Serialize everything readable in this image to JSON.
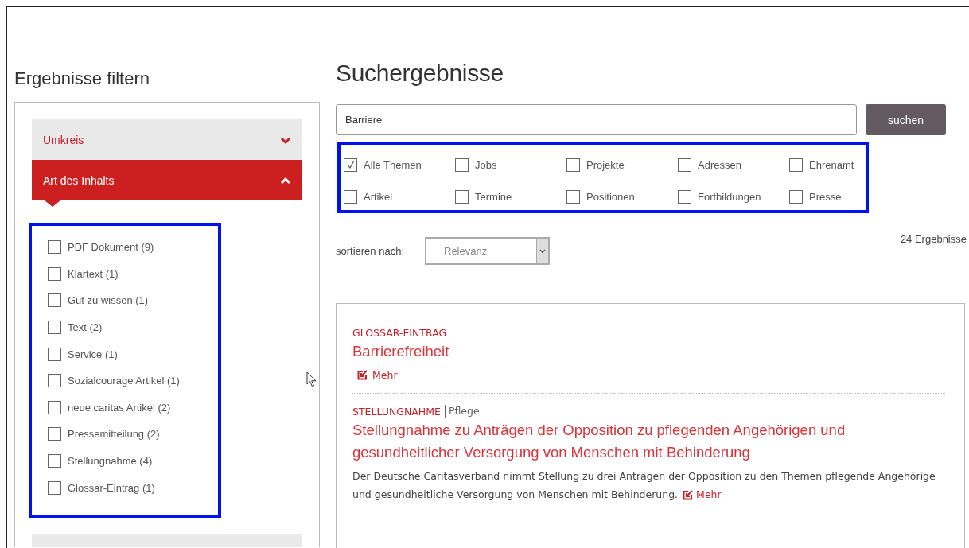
{
  "sidebar": {
    "title": "Ergebnisse filtern",
    "accordion": [
      {
        "label": "Umkreis",
        "expanded": false
      },
      {
        "label": "Art des Inhalts",
        "expanded": true
      }
    ],
    "highlighted": true,
    "content_types": [
      {
        "label": "PDF Dokument (9)",
        "checked": false
      },
      {
        "label": "Klartext (1)",
        "checked": false
      },
      {
        "label": "Gut zu wissen (1)",
        "checked": false
      },
      {
        "label": "Text (2)",
        "checked": false
      },
      {
        "label": "Service (1)",
        "checked": false
      },
      {
        "label": "Sozialcourage Artikel (1)",
        "checked": false
      },
      {
        "label": "neue caritas Artikel (2)",
        "checked": false
      },
      {
        "label": "Pressemitteilung (2)",
        "checked": false
      },
      {
        "label": "Stellungnahme (4)",
        "checked": false
      },
      {
        "label": "Glossar-Eintrag (1)",
        "checked": false
      }
    ]
  },
  "search": {
    "title": "Suchergebnisse",
    "value": "Barriere",
    "button": "suchen",
    "highlighted": true,
    "topics": [
      {
        "label": "Alle Themen",
        "checked": true
      },
      {
        "label": "Jobs",
        "checked": false
      },
      {
        "label": "Projekte",
        "checked": false
      },
      {
        "label": "Adressen",
        "checked": false
      },
      {
        "label": "Ehrenamt",
        "checked": false
      },
      {
        "label": "Artikel",
        "checked": false
      },
      {
        "label": "Termine",
        "checked": false
      },
      {
        "label": "Positionen",
        "checked": false
      },
      {
        "label": "Fortbildungen",
        "checked": false
      },
      {
        "label": "Presse",
        "checked": false
      }
    ],
    "sort_label": "sortieren nach:",
    "sort_value": "Relevanz",
    "result_count": "24 Ergebnisse"
  },
  "results": [
    {
      "type": "GLOSSAR-EINTRAG",
      "title": "Barrierefreiheit",
      "more": "Mehr"
    },
    {
      "type": "STELLUNGNAHME",
      "category": "Pflege",
      "title": "Stellungnahme zu Anträgen der Opposition zu pflegenden Angehörigen und gesundheitlicher Versorgung von Menschen mit Behinderung",
      "teaser": "Der Deutsche Caritasverband nimmt Stellung zu drei Anträgen der Opposition zu den Themen pflegende Angehörige und gesundheitliche Versorgung von Menschen mit Behinderung.",
      "more": "Mehr"
    }
  ]
}
